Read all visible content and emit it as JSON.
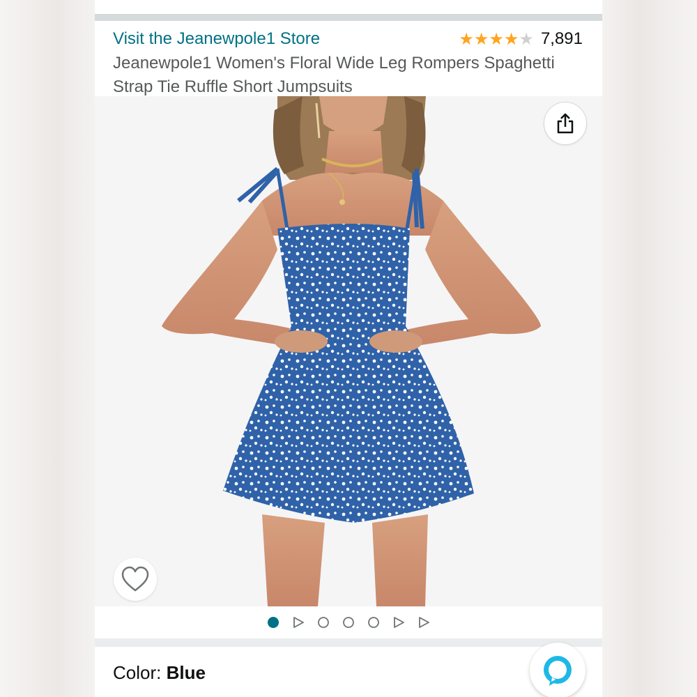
{
  "store": {
    "link_label": "Visit the Jeanewpole1 Store"
  },
  "rating": {
    "stars_filled": 4,
    "stars_total": 5,
    "count": "7,891"
  },
  "product": {
    "title": "Jeanewpole1 Women's Floral Wide Leg Rompers Spaghetti Strap Tie Ruffle Short Jumpsuits",
    "image_alt": "Model wearing blue floral spaghetti strap romper"
  },
  "carousel": {
    "items": [
      "image",
      "video",
      "image",
      "image",
      "image",
      "video",
      "video"
    ],
    "active_index": 0
  },
  "color": {
    "label": "Color:",
    "value": "Blue"
  },
  "icons": {
    "share": "share-icon",
    "wishlist": "heart-icon",
    "assistant": "alexa-icon"
  },
  "colors": {
    "link": "#007185",
    "star": "#ffa41c",
    "dot_active": "#007185",
    "dress": "#2f62a8",
    "alexa": "#1eb8e6"
  }
}
